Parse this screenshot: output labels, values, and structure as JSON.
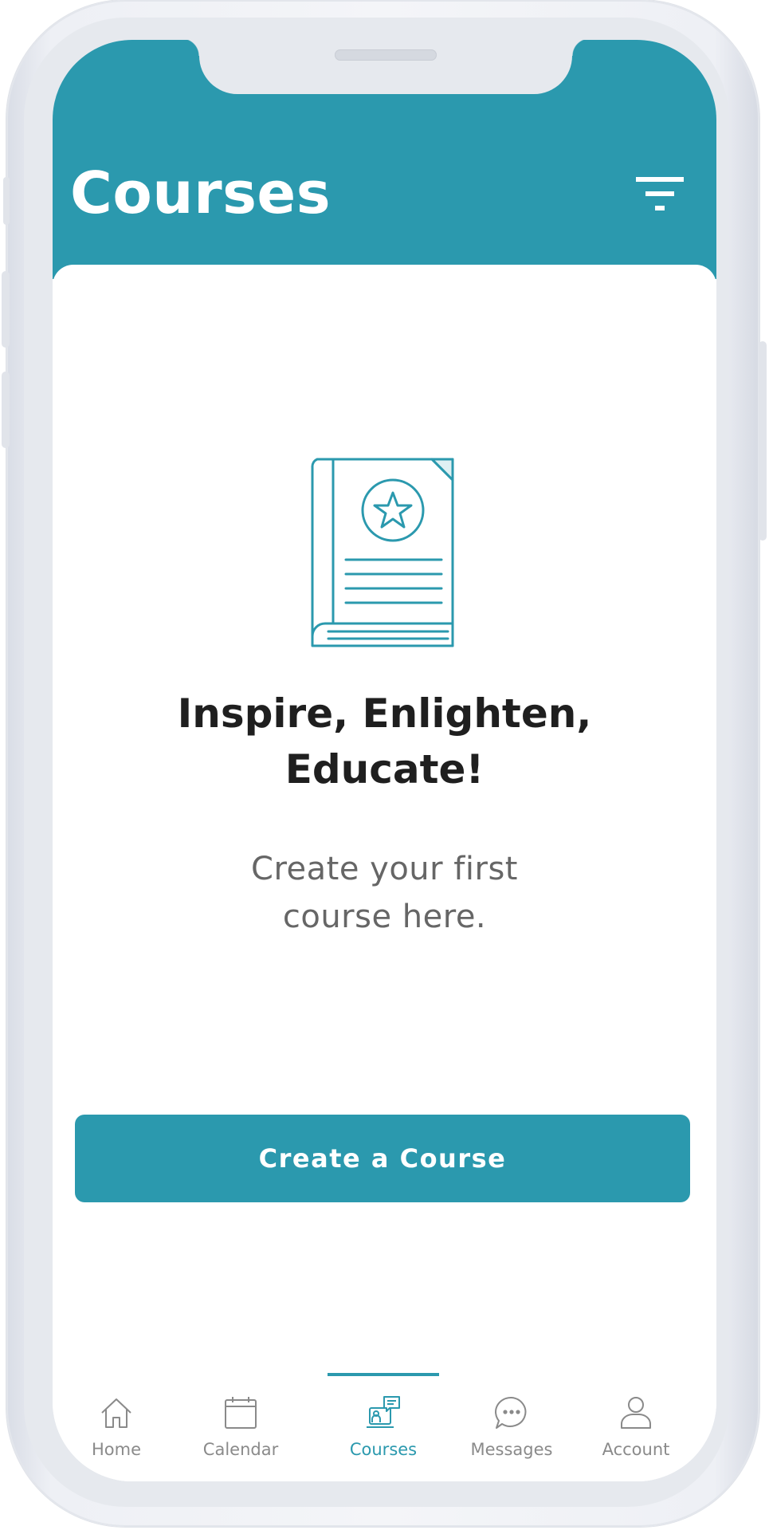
{
  "app": {
    "accent_color": "#2b99ae"
  },
  "header": {
    "title": "Courses",
    "filter_icon": "filter-icon"
  },
  "empty_state": {
    "icon": "book-star-icon",
    "headline_line1": "Inspire, Enlighten,",
    "headline_line2": "Educate!",
    "subtext_line1": "Create your first",
    "subtext_line2": "course here.",
    "button_label": "Create a Course"
  },
  "tabbar": {
    "active_tab": "Courses",
    "tabs": [
      {
        "label": "Home",
        "icon": "home-icon"
      },
      {
        "label": "Calendar",
        "icon": "calendar-icon"
      },
      {
        "label": "Courses",
        "icon": "courses-icon"
      },
      {
        "label": "Messages",
        "icon": "messages-icon"
      },
      {
        "label": "Account",
        "icon": "account-icon"
      }
    ]
  }
}
